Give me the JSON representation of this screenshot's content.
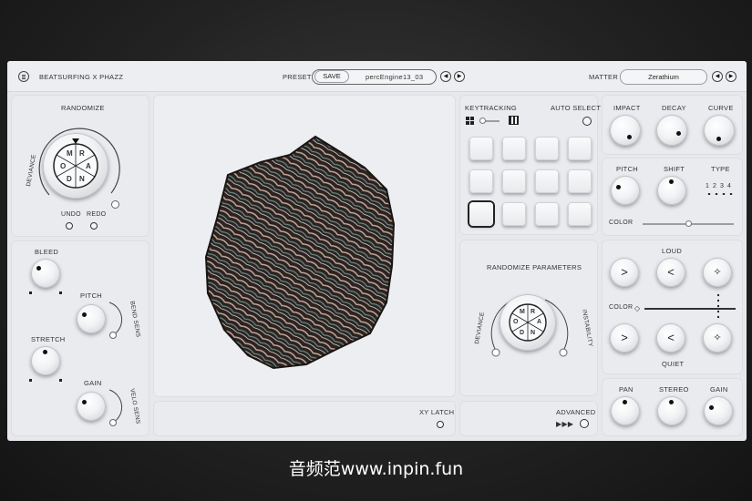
{
  "header": {
    "menu_icon": "menu-icon",
    "brand": "BEATSURFING X PHAZZ",
    "preset_label": "PRESET",
    "save_label": "SAVE",
    "preset_name": "percEngine13_03",
    "matter_label": "MATTER",
    "matter_name": "Zerathium"
  },
  "randomize": {
    "title": "RANDOMIZE",
    "deviance": "DEVIANCE",
    "wheel": [
      "M",
      "R",
      "A",
      "N",
      "D",
      "O"
    ],
    "undo": "UNDO",
    "redo": "REDO"
  },
  "left": {
    "bleed": "BLEED",
    "pitch": "PITCH",
    "bend_sens": "BEND SENS",
    "stretch": "STRETCH",
    "gain": "GAIN",
    "velo_sens": "VELO SENS"
  },
  "center": {
    "xy_latch": "XY LATCH"
  },
  "pads": {
    "keytracking": "KEYTRACKING",
    "auto_select": "AUTO SELECT",
    "selected_index": 8
  },
  "rand_params": {
    "title": "RANDOMIZE PARAMETERS",
    "deviance": "DEVIANCE",
    "instability": "INSTABILITY",
    "advanced": "ADVANCED",
    "advanced_arrows": "▶▶▶"
  },
  "env": {
    "impact": "IMPACT",
    "decay": "DECAY",
    "curve": "CURVE"
  },
  "pitchsec": {
    "pitch": "PITCH",
    "shift": "SHIFT",
    "type": "TYPE",
    "type_options": [
      "1",
      "2",
      "3",
      "4"
    ],
    "color": "COLOR"
  },
  "loud": {
    "loud": "LOUD",
    "color": "COLOR",
    "quiet": "QUIET"
  },
  "out": {
    "pan": "PAN",
    "stereo": "STEREO",
    "gain": "GAIN"
  },
  "watermark": "音频范www.inpin.fun"
}
